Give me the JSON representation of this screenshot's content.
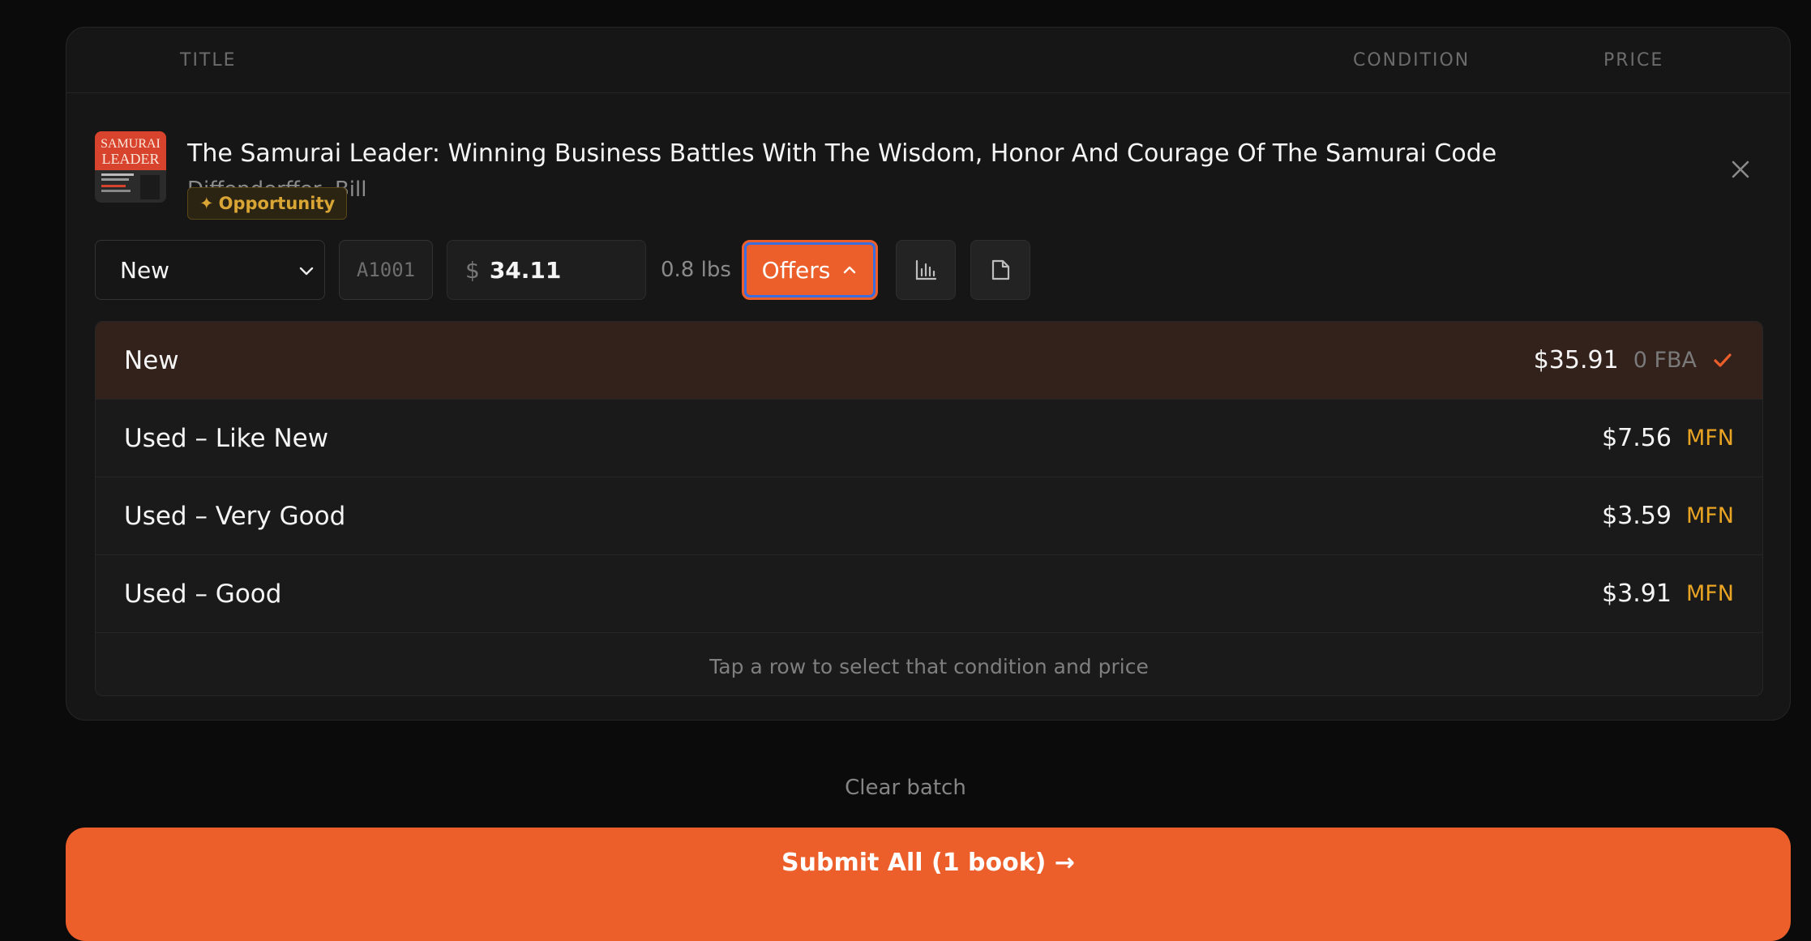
{
  "table_header": {
    "title": "TITLE",
    "condition": "CONDITION",
    "price": "PRICE"
  },
  "book": {
    "title": "The Samurai Leader: Winning Business Battles With The Wisdom, Honor And Courage Of The Samurai Code",
    "author": "Diffenderffer, Bill",
    "badge": "Opportunity",
    "badge_icon": "sparkle-icon",
    "cover_text_line1": "SAMURAI",
    "cover_text_line2": "LEADER"
  },
  "controls": {
    "condition_value": "New",
    "sku_placeholder": "A1001",
    "currency_symbol": "$",
    "price_value": "34.11",
    "weight": "0.8 lbs",
    "offers_label": "Offers",
    "chart_icon": "bar-chart-icon",
    "doc_icon": "document-icon"
  },
  "offers": [
    {
      "condition": "New",
      "price": "$35.91",
      "type": "0 FBA",
      "selected": true
    },
    {
      "condition": "Used – Like New",
      "price": "$7.56",
      "type": "MFN",
      "selected": false
    },
    {
      "condition": "Used – Very Good",
      "price": "$3.59",
      "type": "MFN",
      "selected": false
    },
    {
      "condition": "Used – Good",
      "price": "$3.91",
      "type": "MFN",
      "selected": false
    }
  ],
  "offers_hint": "Tap a row to select that condition and price",
  "footer": {
    "clear_label": "Clear batch",
    "submit_label": "Submit All (1 book) →"
  },
  "colors": {
    "accent": "#ec5f2a",
    "mfn": "#e8a422",
    "selected_row": "#33211b",
    "badge": "#d9a534"
  }
}
